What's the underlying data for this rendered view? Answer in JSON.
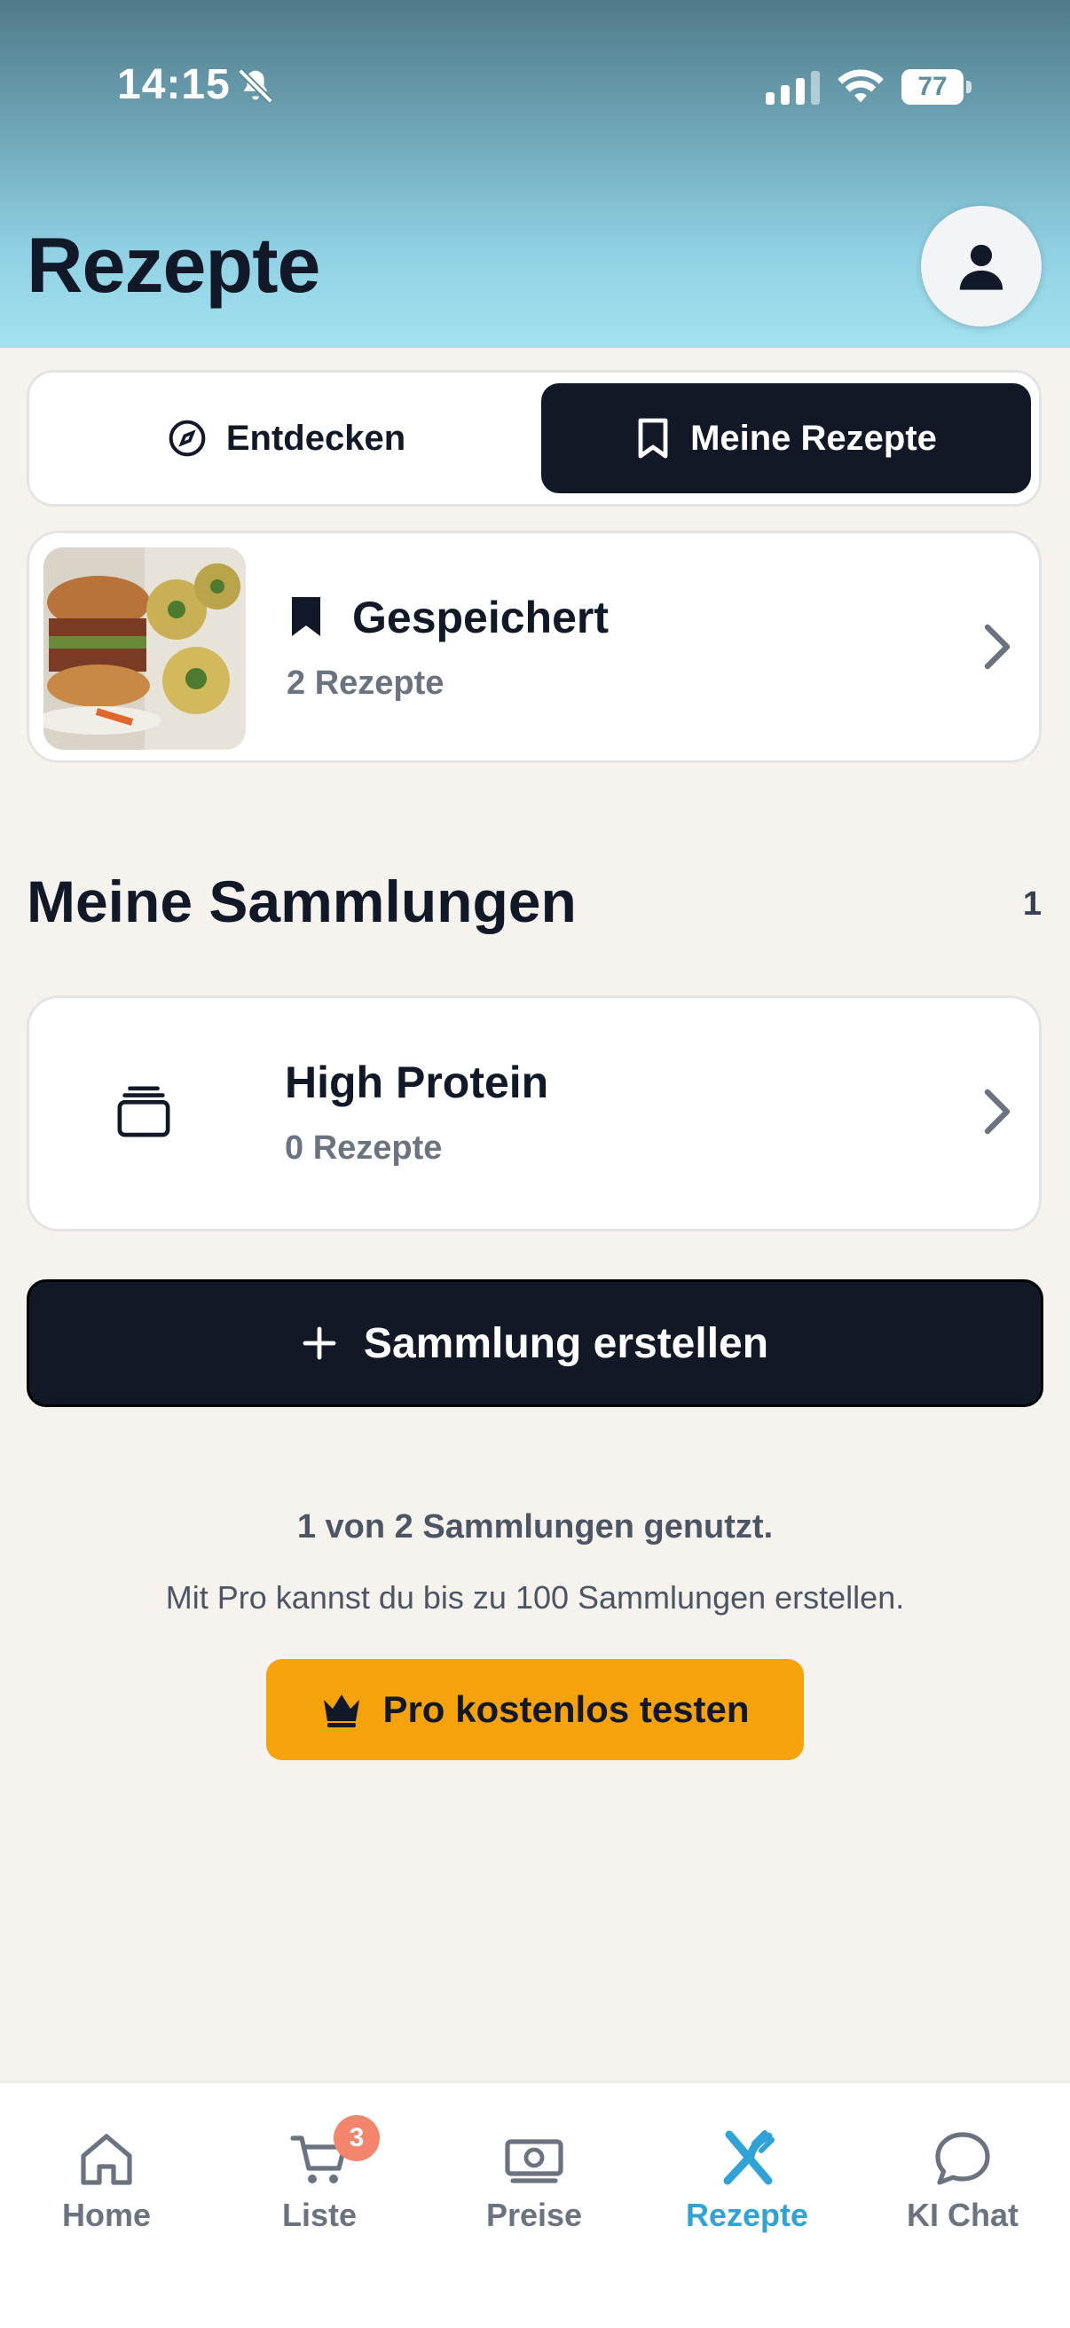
{
  "status_bar": {
    "time": "14:15",
    "battery": "77"
  },
  "header": {
    "title": "Rezepte"
  },
  "tabs": {
    "discover": "Entdecken",
    "mine": "Meine Rezepte"
  },
  "saved": {
    "title": "Gespeichert",
    "count": "2 Rezepte"
  },
  "collections": {
    "title": "Meine Sammlungen",
    "count": "1",
    "items": [
      {
        "title": "High Protein",
        "count": "0 Rezepte"
      }
    ],
    "create_label": "Sammlung erstellen"
  },
  "usage": {
    "line1": "1 von 2 Sammlungen genutzt.",
    "line2": "Mit Pro kannst du bis zu 100 Sammlungen erstellen.",
    "pro_button": "Pro kostenlos testen"
  },
  "bottom_nav": {
    "items": [
      {
        "label": "Home",
        "icon": "home-icon"
      },
      {
        "label": "Liste",
        "icon": "cart-icon",
        "badge": "3"
      },
      {
        "label": "Preise",
        "icon": "money-icon"
      },
      {
        "label": "Rezepte",
        "icon": "fork-knife-icon",
        "active": true
      },
      {
        "label": "KI Chat",
        "icon": "chat-icon"
      }
    ]
  },
  "colors": {
    "accent_dark": "#121826",
    "pro_orange": "#f5a20b",
    "active_tab": "#2fa3d8",
    "badge": "#f4856d"
  }
}
